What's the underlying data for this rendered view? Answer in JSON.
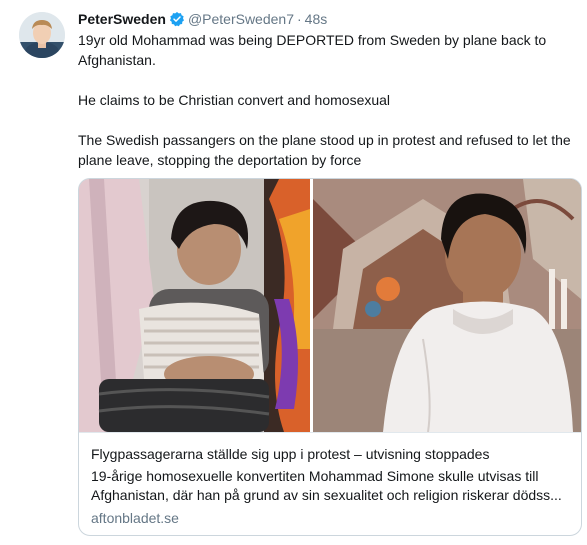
{
  "tweet": {
    "author_name": "PeterSweden",
    "author_handle": "@PeterSweden7",
    "separator": "·",
    "timestamp": "48s",
    "text_line1": "19yr old Mohammad was being DEPORTED from Sweden by plane back to Afghanistan.",
    "text_line2": "He claims to be Christian convert and homosexual",
    "text_line3": "The Swedish passangers on the plane stood up in protest and refused to let the plane leave, stopping the deportation by force"
  },
  "card": {
    "title": "Flygpassagerarna ställde sig upp i protest – utvisning stoppades",
    "description": "19-årige homosexuelle konvertiten Mohammad Simone skulle utvisas till Afghanistan, där han på grund av sin sexualitet och religion riskerar dödss...",
    "domain": "aftonbladet.se"
  },
  "colors": {
    "verified_blue": "#1da1f2",
    "secondary_text": "#657786",
    "border": "#ccd6dd"
  },
  "icons": {
    "verified": "verified-badge-icon",
    "avatar": "avatar"
  }
}
